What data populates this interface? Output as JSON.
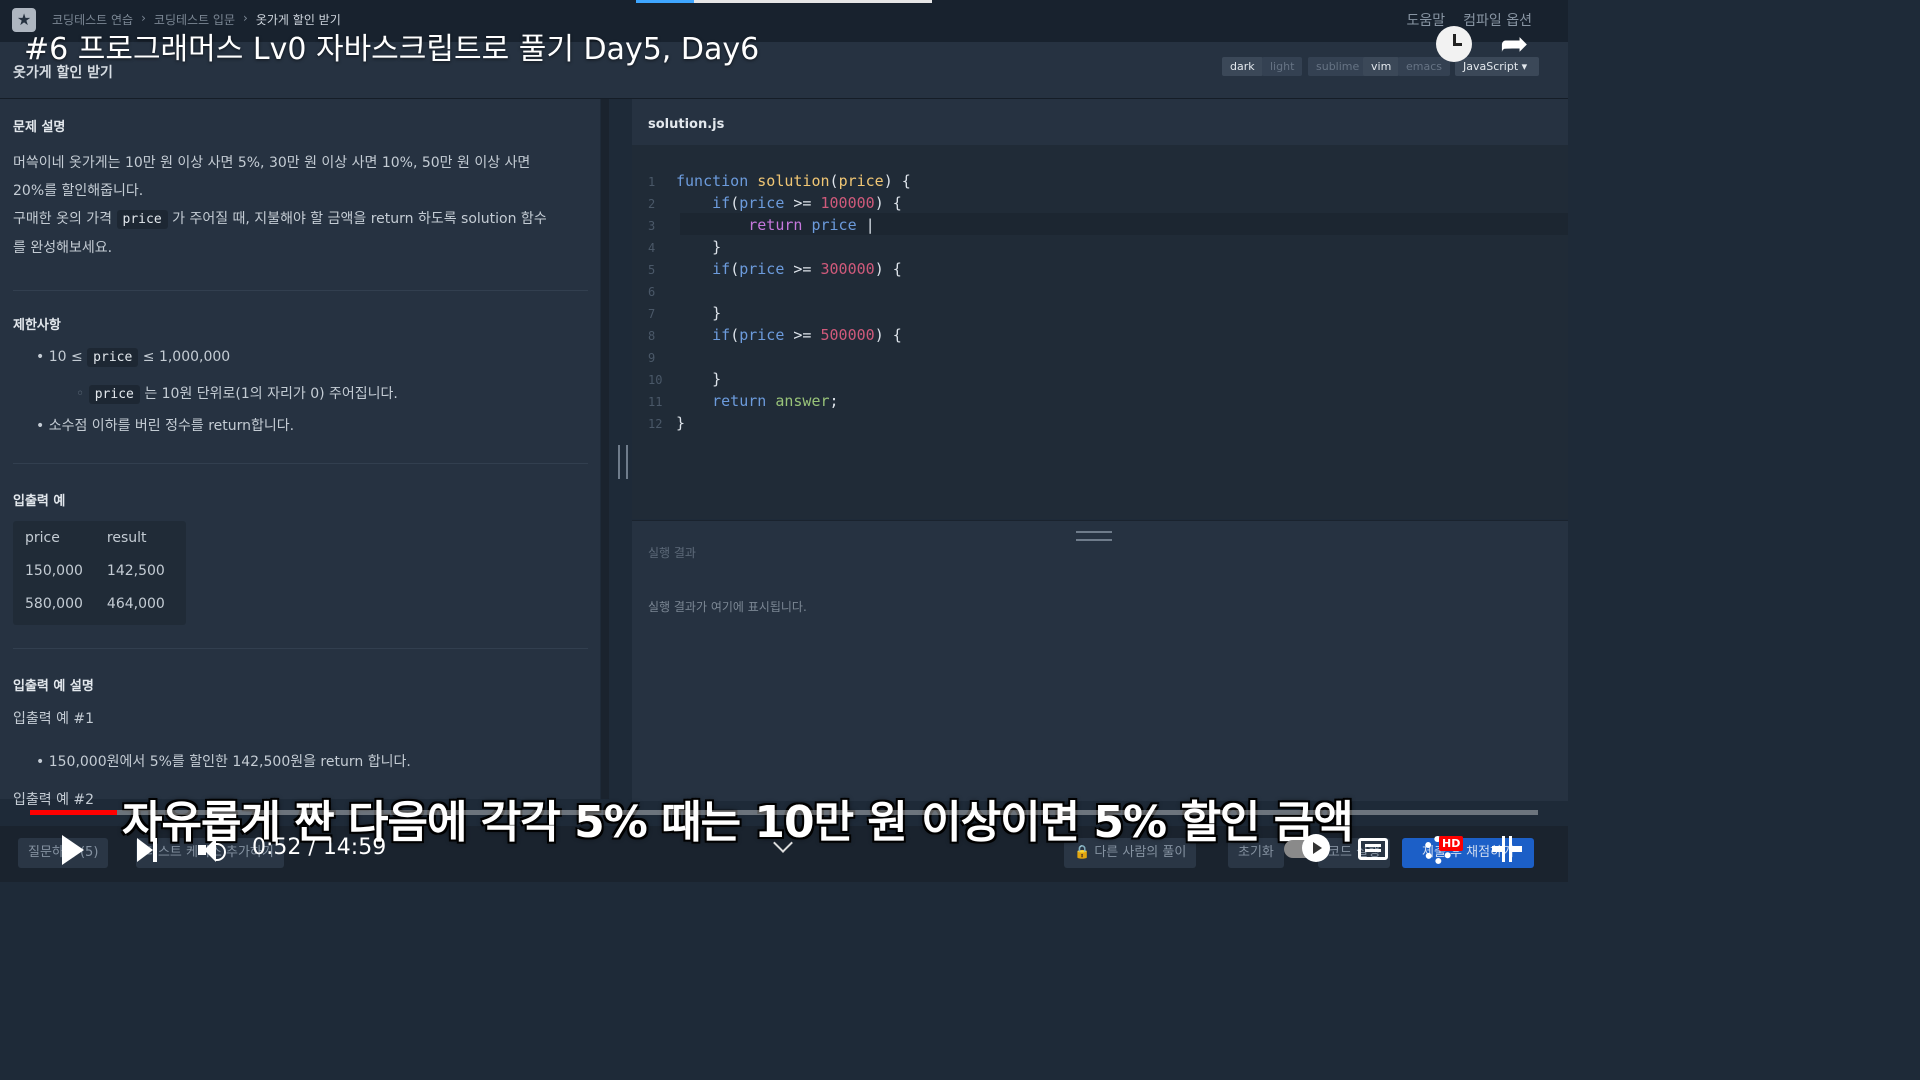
{
  "header": {
    "breadcrumb": [
      "코딩테스트 연습",
      "코딩테스트 입문",
      "옷가게 할인 받기"
    ],
    "help": "도움말",
    "compile_options": "컴파일 옵션"
  },
  "video": {
    "title": "#6 프로그래머스 Lv0 자바스크립트로 풀기 Day5, Day6",
    "subtitle": "자유롭게 짠 다음에 각각 5% 때는 10만 원 이상이면 5% 할인 금액",
    "time_current": "0:52",
    "time_total": "14:59",
    "time_separator": " / ",
    "progress_fraction": 0.058,
    "hd_label": "HD"
  },
  "problem": {
    "title": "옷가게 할인 받기",
    "description_heading": "문제 설명",
    "description_line1": "머쓱이네 옷가게는 10만 원 이상 사면 5%, 30만 원 이상 사면 10%, 50만 원 이상 사면",
    "description_line2": "20%를 할인해줍니다.",
    "description_line3_a": "구매한 옷의 가격",
    "description_line3_b": "가 주어질 때, 지불해야 할 금액을 return 하도록 solution 함수",
    "description_line4": "를 완성해보세요.",
    "param_name": "price",
    "constraints_heading": "제한사항",
    "constraint1_a": "10 ≤",
    "constraint1_b": "≤ 1,000,000",
    "constraint1_sub": "는 10원 단위로(1의 자리가 0) 주어집니다.",
    "constraint2": "소수점 이하를 버린 정수를 return합니다.",
    "io_heading": "입출력 예",
    "io_columns": [
      "price",
      "result"
    ],
    "io_rows": [
      [
        "150,000",
        "142,500"
      ],
      [
        "580,000",
        "464,000"
      ]
    ],
    "io_explain_heading": "입출력 예 설명",
    "io_example1": "입출력 예 #1",
    "io_example1_text": "150,000원에서 5%를 할인한 142,500원을 return 합니다.",
    "io_example2": "입출력 예 #2"
  },
  "editor": {
    "options": [
      "dark",
      "light",
      "sublime",
      "vim",
      "emacs"
    ],
    "language": "JavaScript",
    "filename": "solution.js",
    "line_numbers": [
      "1",
      "2",
      "3",
      "4",
      "5",
      "6",
      "7",
      "8",
      "9",
      "10",
      "11",
      "12"
    ],
    "result_heading": "실행 결과",
    "result_placeholder": "실행 결과가 여기에 표시됩니다."
  },
  "toolbar": {
    "questions": "질문하기 (5)",
    "test_case": "테스트 케이스 추가하기",
    "others_solution": "다른 사람의 풀이",
    "reset": "초기화",
    "run": "코드 실행",
    "submit": "제출 후 채점하기"
  }
}
